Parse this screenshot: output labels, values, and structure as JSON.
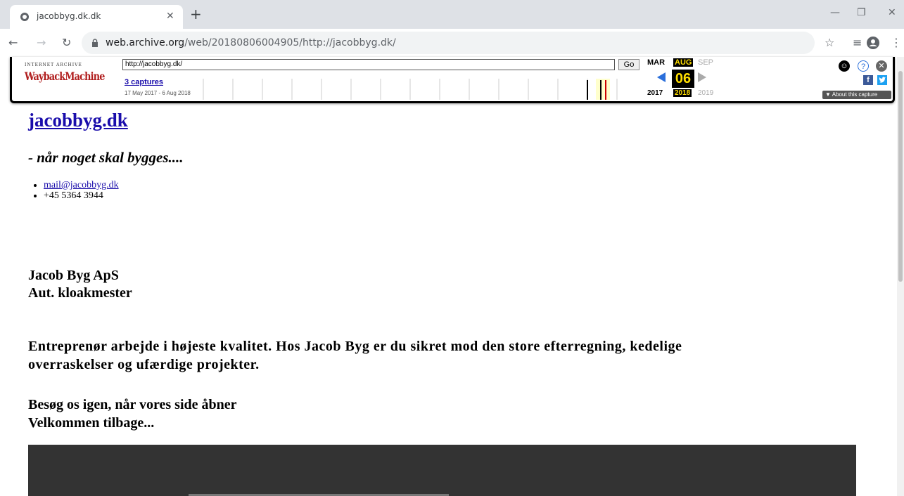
{
  "browser": {
    "tab_title": "jacobbyg.dk.dk",
    "new_tab": "+",
    "url_host": "web.archive.org",
    "url_path": "/web/20180806004905/http://jacobbyg.dk/"
  },
  "wayback": {
    "logo_top": "INTERNET ARCHIVE",
    "logo": "WaybackMachine",
    "url_value": "http://jacobbyg.dk/",
    "go_label": "Go",
    "captures_label": "3 captures",
    "range_label": "17 May 2017 - 6 Aug 2018",
    "month_prev": "MAR",
    "month_cur": "AUG",
    "month_next": "SEP",
    "day": "06",
    "year_prev": "2017",
    "year_cur": "2018",
    "year_next": "2019",
    "about_label": "▼ About this capture",
    "accent_color": "#ffde00"
  },
  "page": {
    "site_title": "jacobbyg.dk",
    "tagline": "- når noget skal bygges....",
    "contact_email": "mail@jacobbyg.dk",
    "contact_phone": "+45 5364 3944",
    "company_name": "Jacob Byg ApS",
    "company_title": "Aut. kloakmester",
    "description": "Entreprenør arbejde i højeste kvalitet. Hos Jacob Byg er du sikret mod den store efterregning, kedelige overraskelser og ufærdige projekter.",
    "revisit_line1": "Besøg os igen, når vores side åbner",
    "revisit_line2": "Velkommen tilbage..."
  }
}
